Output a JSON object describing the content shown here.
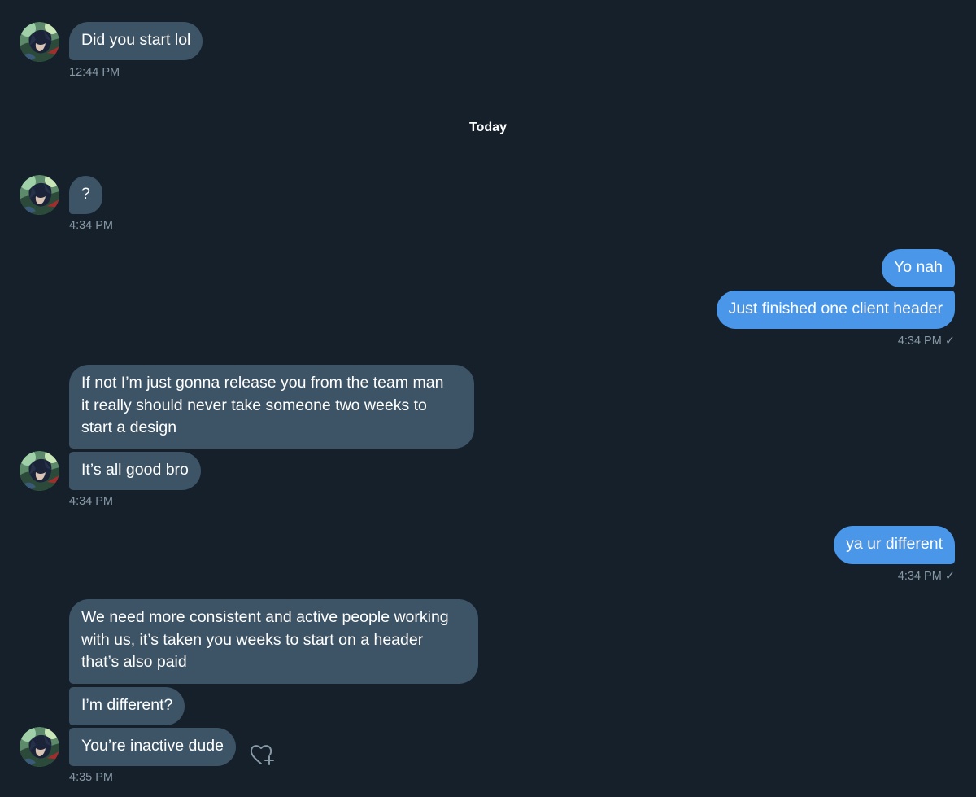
{
  "day_separator": "Today",
  "messages": [
    {
      "text": "Did you start lol",
      "time": "12:44 PM"
    },
    {
      "text": "?",
      "time": "4:34 PM"
    },
    {
      "text": "Yo nah"
    },
    {
      "text": "Just finished one client header",
      "time": "4:34 PM ✓"
    },
    {
      "text": "If not I’m just gonna release you from the team man\nit really should never take someone two weeks to\nstart a design"
    },
    {
      "text": "It’s all good bro",
      "time": "4:34 PM"
    },
    {
      "text": "ya ur different",
      "time": "4:34 PM ✓"
    },
    {
      "text": "We need more consistent and active people working\nwith us, it’s taken you weeks to start on a header\nthat’s also paid"
    },
    {
      "text": "I’m different?"
    },
    {
      "text": "You’re inactive dude",
      "time": "4:35 PM"
    }
  ],
  "icons": {
    "avatar": "user-avatar",
    "react": "heart-plus-icon"
  },
  "colors": {
    "background": "#15202b",
    "received_bubble": "#3d5466",
    "sent_bubble": "#4a96e8",
    "timestamp": "#8899a6"
  }
}
